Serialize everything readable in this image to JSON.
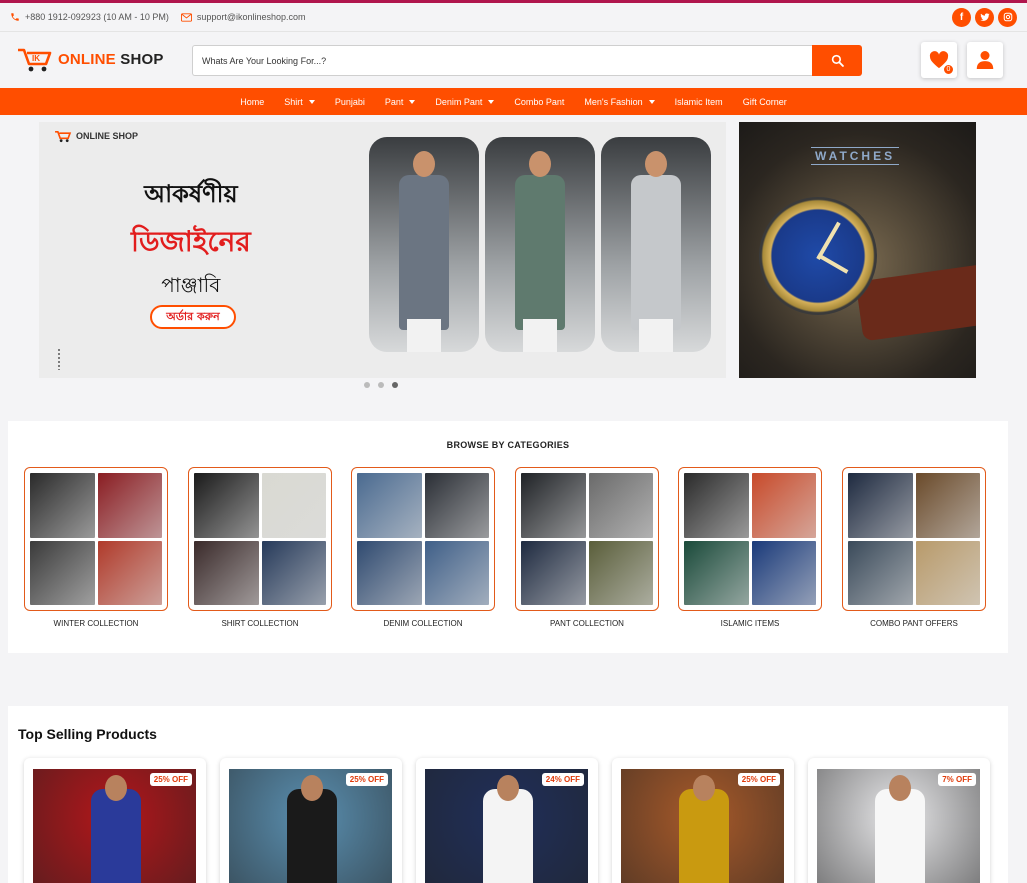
{
  "topbar": {
    "phone": "+880 1912-092923 (10 AM - 10 PM)",
    "email": "support@ikonlineshop.com",
    "social": [
      "facebook-icon",
      "twitter-icon",
      "instagram-icon"
    ]
  },
  "header": {
    "logo_mark": "IK",
    "logo_word1": "ONLINE",
    "logo_word2": "SHOP",
    "search_placeholder": "Whats Are Your Looking For...?",
    "wishlist_count": "0"
  },
  "nav": [
    {
      "label": "Home",
      "dropdown": false
    },
    {
      "label": "Shirt",
      "dropdown": true
    },
    {
      "label": "Punjabi",
      "dropdown": false
    },
    {
      "label": "Pant",
      "dropdown": true
    },
    {
      "label": "Denim Pant",
      "dropdown": true
    },
    {
      "label": "Combo Pant",
      "dropdown": false
    },
    {
      "label": "Men's Fashion",
      "dropdown": true
    },
    {
      "label": "Islamic Item",
      "dropdown": false
    },
    {
      "label": "Gift Corner",
      "dropdown": false
    }
  ],
  "hero": {
    "logo_text": "ONLINE SHOP",
    "line1": "আকর্ষণীয়",
    "line2": "ডিজাইনের",
    "line3": "পাঞ্জাবি",
    "cta": "অর্ডার করুন",
    "promo_title": "WATCHES",
    "slides": 3,
    "active_slide": 2
  },
  "categories": {
    "title": "BROWSE BY CATEGORIES",
    "items": [
      {
        "label": "WINTER COLLECTION",
        "colors": [
          "#2a2a2a",
          "#8a1d22",
          "#3a3a3a",
          "#b03a2a"
        ]
      },
      {
        "label": "SHIRT COLLECTION",
        "colors": [
          "#1a1a1a",
          "#d9d9d2",
          "#3a2a2a",
          "#263a5a"
        ]
      },
      {
        "label": "DENIM COLLECTION",
        "colors": [
          "#4a6a90",
          "#2a2e35",
          "#2f4a70",
          "#3f5f88"
        ]
      },
      {
        "label": "PANT COLLECTION",
        "colors": [
          "#1f2226",
          "#6a6a6a",
          "#1e2a40",
          "#5a5e3a"
        ]
      },
      {
        "label": "ISLAMIC ITEMS",
        "colors": [
          "#2a2a2a",
          "#c84a2a",
          "#1a4a3a",
          "#1a3a7a"
        ]
      },
      {
        "label": "COMBO PANT OFFERS",
        "colors": [
          "#1e2a40",
          "#6a4a2a",
          "#3a4a5a",
          "#b89a6a"
        ]
      }
    ]
  },
  "top_selling": {
    "title": "Top Selling Products",
    "products": [
      {
        "discount": "25% OFF",
        "bg": "#b3161a",
        "outfit": "#2a3a9a"
      },
      {
        "discount": "25% OFF",
        "bg": "#5a8fb0",
        "outfit": "#1a1a1a"
      },
      {
        "discount": "24% OFF",
        "bg": "#1f2f5a",
        "outfit": "#f4f4f4"
      },
      {
        "discount": "25% OFF",
        "bg": "#a85a2a",
        "outfit": "#c99a10"
      },
      {
        "discount": "7% OFF",
        "bg": "#e8e8ea",
        "outfit": "#f7f7f7"
      }
    ]
  },
  "colors": {
    "accent": "#ff4e00",
    "top_strip": "#b0154d"
  }
}
